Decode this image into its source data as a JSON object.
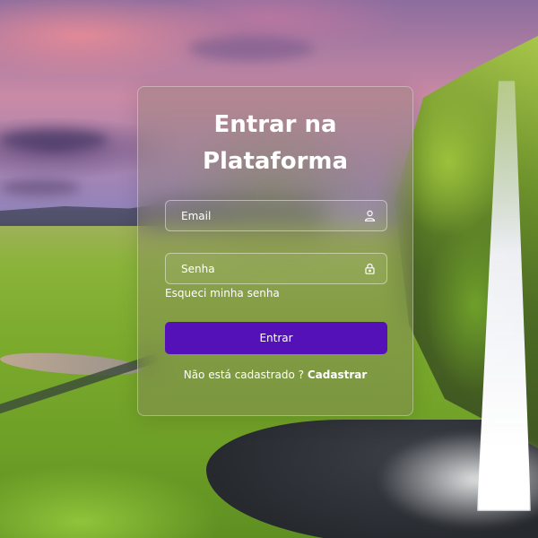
{
  "login": {
    "title": "Entrar na Plataforma",
    "email_placeholder": "Email",
    "email_value": "",
    "password_placeholder": "Senha",
    "password_value": "",
    "forgot_password": "Esqueci minha senha",
    "submit_label": "Entrar",
    "signup_prompt": "Não está cadastrado ?",
    "signup_link": "Cadastrar"
  },
  "icons": {
    "email": "user-icon",
    "password": "lock-icon"
  },
  "colors": {
    "primary_button": "#5511b8",
    "text": "#ffffff"
  }
}
